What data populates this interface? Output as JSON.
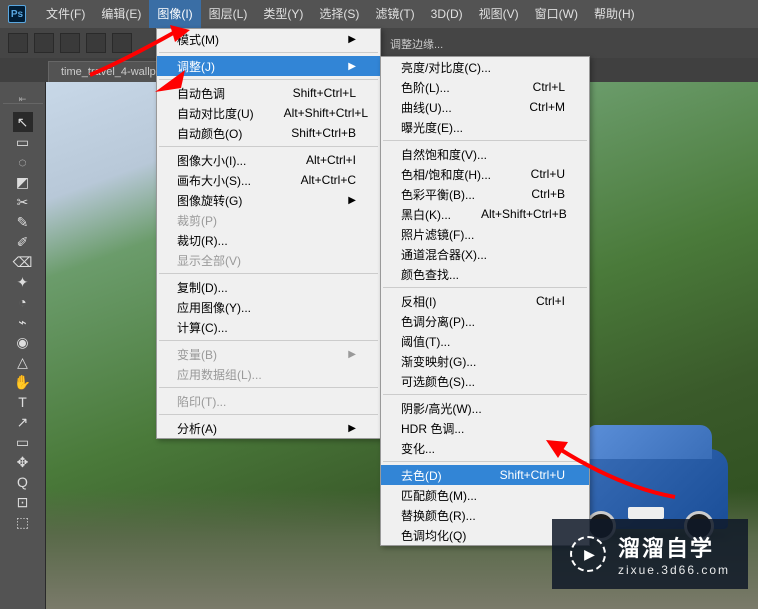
{
  "app_icon": "Ps",
  "menubar": [
    "文件(F)",
    "编辑(E)",
    "图像(I)",
    "图层(L)",
    "类型(Y)",
    "选择(S)",
    "滤镜(T)",
    "3D(D)",
    "视图(V)",
    "窗口(W)",
    "帮助(H)"
  ],
  "menubar_active_index": 2,
  "open_tab": "time_travel_4-wallp",
  "extra_label": "调整边缘...",
  "tools": [
    "↖",
    "▭",
    "◌",
    "◩",
    "✂",
    "✎",
    "✐",
    "⌫",
    "✦",
    "◔",
    "⌁",
    "◉",
    "△",
    "✋",
    "T",
    "↗",
    "▭",
    "✥",
    "Q",
    "⊡",
    "⬚"
  ],
  "menu1": [
    {
      "label": "模式(M)",
      "arrow": true
    },
    {
      "sep": true
    },
    {
      "label": "调整(J)",
      "arrow": true,
      "highlighted": true
    },
    {
      "sep": true
    },
    {
      "label": "自动色调",
      "shortcut": "Shift+Ctrl+L"
    },
    {
      "label": "自动对比度(U)",
      "shortcut": "Alt+Shift+Ctrl+L"
    },
    {
      "label": "自动颜色(O)",
      "shortcut": "Shift+Ctrl+B"
    },
    {
      "sep": true
    },
    {
      "label": "图像大小(I)...",
      "shortcut": "Alt+Ctrl+I"
    },
    {
      "label": "画布大小(S)...",
      "shortcut": "Alt+Ctrl+C"
    },
    {
      "label": "图像旋转(G)",
      "arrow": true
    },
    {
      "label": "裁剪(P)",
      "disabled": true
    },
    {
      "label": "裁切(R)..."
    },
    {
      "label": "显示全部(V)",
      "disabled": true
    },
    {
      "sep": true
    },
    {
      "label": "复制(D)..."
    },
    {
      "label": "应用图像(Y)..."
    },
    {
      "label": "计算(C)..."
    },
    {
      "sep": true
    },
    {
      "label": "变量(B)",
      "arrow": true,
      "disabled": true
    },
    {
      "label": "应用数据组(L)...",
      "disabled": true
    },
    {
      "sep": true
    },
    {
      "label": "陷印(T)...",
      "disabled": true
    },
    {
      "sep": true
    },
    {
      "label": "分析(A)",
      "arrow": true
    }
  ],
  "menu2": [
    {
      "label": "亮度/对比度(C)..."
    },
    {
      "label": "色阶(L)...",
      "shortcut": "Ctrl+L"
    },
    {
      "label": "曲线(U)...",
      "shortcut": "Ctrl+M"
    },
    {
      "label": "曝光度(E)..."
    },
    {
      "sep": true
    },
    {
      "label": "自然饱和度(V)..."
    },
    {
      "label": "色相/饱和度(H)...",
      "shortcut": "Ctrl+U"
    },
    {
      "label": "色彩平衡(B)...",
      "shortcut": "Ctrl+B"
    },
    {
      "label": "黑白(K)...",
      "shortcut": "Alt+Shift+Ctrl+B"
    },
    {
      "label": "照片滤镜(F)..."
    },
    {
      "label": "通道混合器(X)..."
    },
    {
      "label": "颜色查找..."
    },
    {
      "sep": true
    },
    {
      "label": "反相(I)",
      "shortcut": "Ctrl+I"
    },
    {
      "label": "色调分离(P)..."
    },
    {
      "label": "阈值(T)..."
    },
    {
      "label": "渐变映射(G)..."
    },
    {
      "label": "可选颜色(S)..."
    },
    {
      "sep": true
    },
    {
      "label": "阴影/高光(W)..."
    },
    {
      "label": "HDR 色调..."
    },
    {
      "label": "变化..."
    },
    {
      "sep": true
    },
    {
      "label": "去色(D)",
      "shortcut": "Shift+Ctrl+U",
      "highlighted": true
    },
    {
      "label": "匹配颜色(M)..."
    },
    {
      "label": "替换颜色(R)..."
    },
    {
      "label": "色调均化(Q)"
    }
  ],
  "watermark": {
    "title": "溜溜自学",
    "url": "zixue.3d66.com"
  }
}
